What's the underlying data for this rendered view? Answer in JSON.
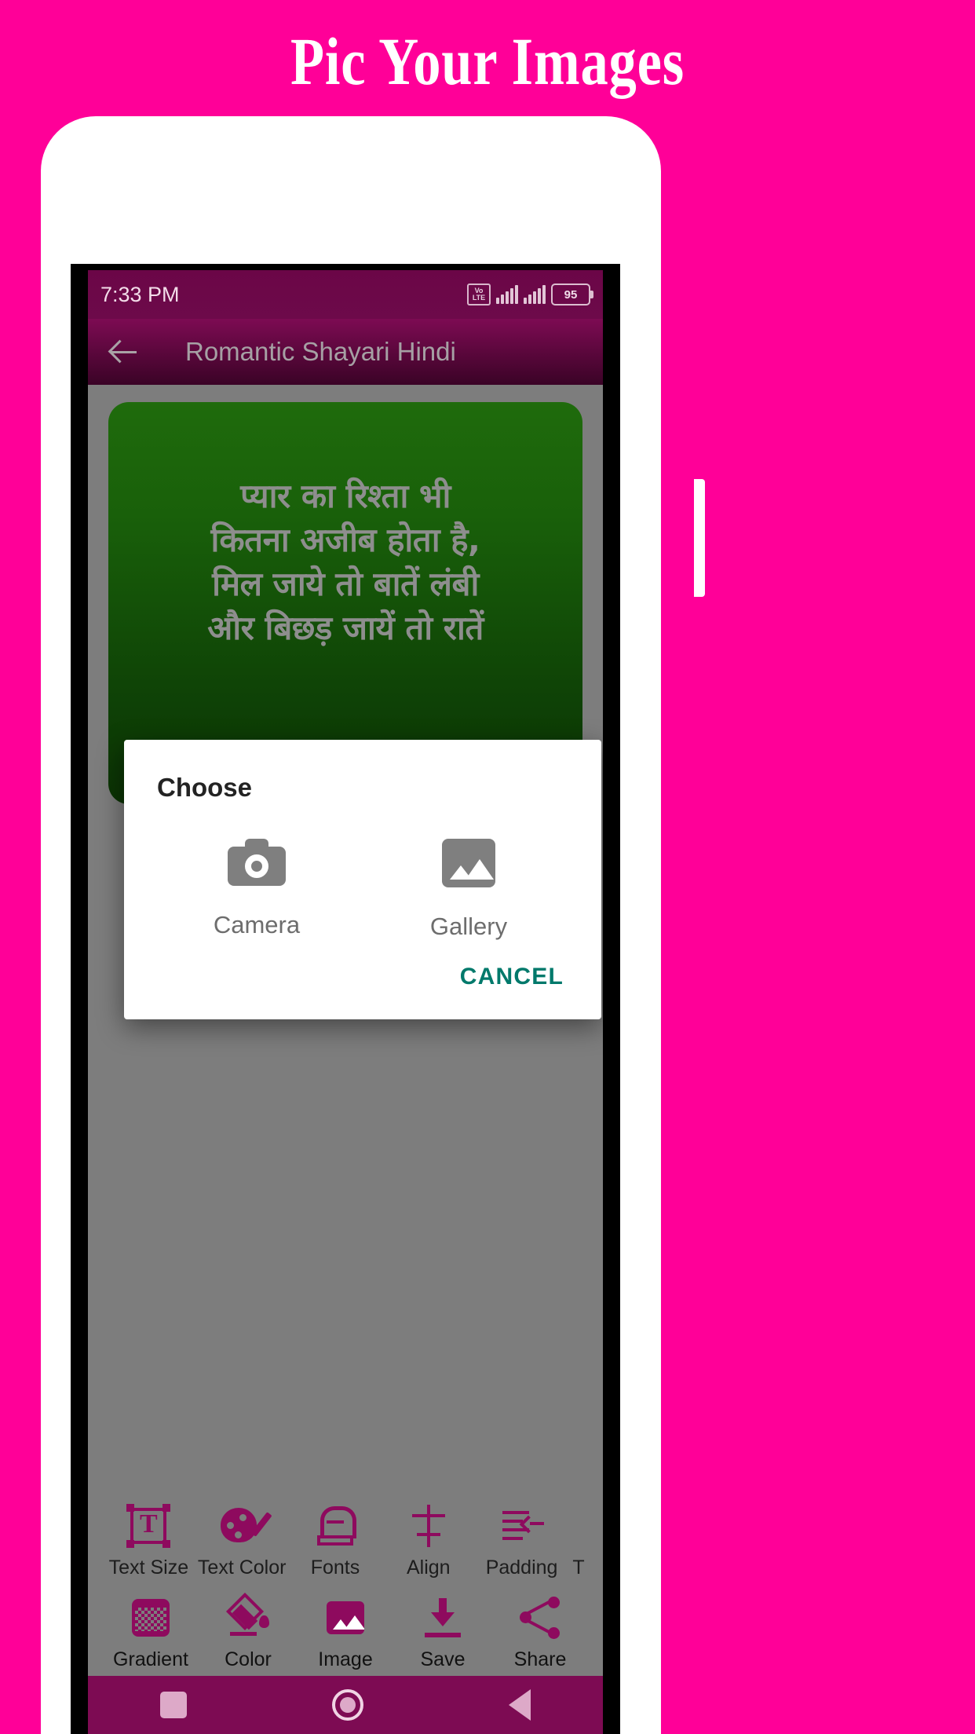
{
  "promo": {
    "title": "Pic Your Images",
    "background_color": "#FF0098"
  },
  "statusbar": {
    "time": "7:33 PM",
    "volte_line1": "Vo",
    "volte_line2": "LTE",
    "battery_percent": "95",
    "background_color": "#6b0647"
  },
  "appbar": {
    "back_icon": "arrow-left-icon",
    "title": "Romantic Shayari Hindi",
    "background_color": "#7d0b53"
  },
  "canvas": {
    "card_gradient_from": "#1f6b0c",
    "card_gradient_to": "#0b3304",
    "text_color": "#8e8e8e",
    "shayari_lines": [
      "प्यार का रिश्ता भी",
      "कितना अजीब होता है,",
      "मिल जाये तो बातें लंबी",
      "और बिछड़ जायें तो रातें"
    ]
  },
  "dialog": {
    "title": "Choose",
    "options": [
      {
        "label": "Camera",
        "icon": "camera-icon"
      },
      {
        "label": "Gallery",
        "icon": "image-icon"
      }
    ],
    "cancel_label": "CANCEL",
    "cancel_color": "#00796b"
  },
  "toolbar": {
    "accent_color": "#8e0a5e",
    "row1": [
      {
        "label": "Text Size",
        "icon": "text-size-icon"
      },
      {
        "label": "Text Color",
        "icon": "palette-icon"
      },
      {
        "label": "Fonts",
        "icon": "fonts-icon"
      },
      {
        "label": "Align",
        "icon": "align-icon"
      },
      {
        "label": "Padding",
        "icon": "padding-icon"
      },
      {
        "label": "T",
        "icon": "cut-off-icon"
      }
    ],
    "row2": [
      {
        "label": "Gradient",
        "icon": "gradient-icon"
      },
      {
        "label": "Color",
        "icon": "fill-color-icon"
      },
      {
        "label": "Image",
        "icon": "image-icon"
      },
      {
        "label": "Save",
        "icon": "download-icon"
      },
      {
        "label": "Share",
        "icon": "share-icon"
      }
    ]
  },
  "navbar": {
    "recents": "square-icon",
    "home": "circle-icon",
    "back": "triangle-back-icon",
    "background_color": "#7d0b53"
  }
}
